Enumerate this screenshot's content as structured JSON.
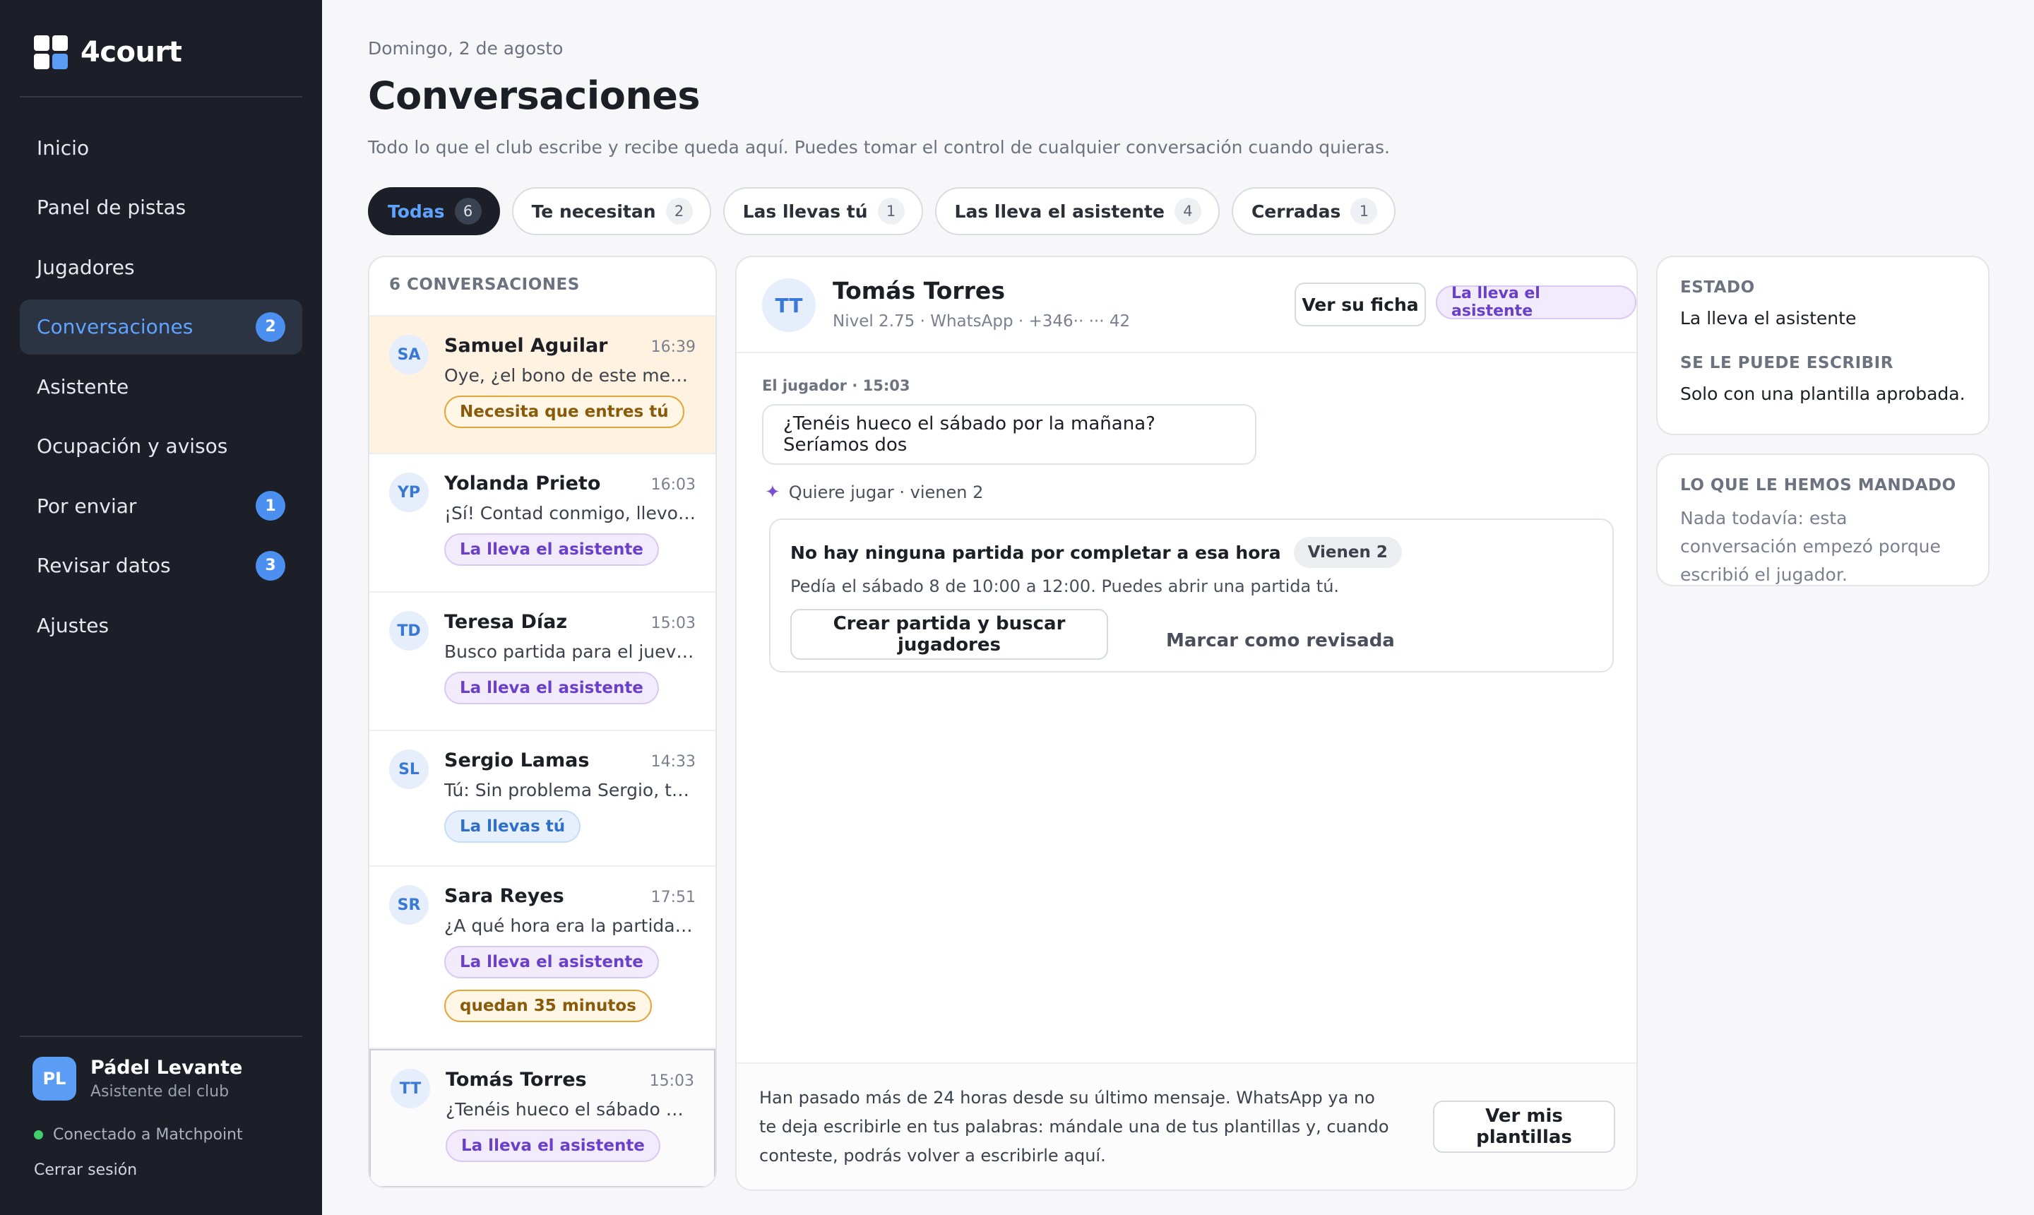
{
  "brand": {
    "name": "4court"
  },
  "sidebar": {
    "items": [
      {
        "label": "Inicio",
        "badge": ""
      },
      {
        "label": "Panel de pistas",
        "badge": ""
      },
      {
        "label": "Jugadores",
        "badge": ""
      },
      {
        "label": "Conversaciones",
        "badge": "2"
      },
      {
        "label": "Asistente",
        "badge": ""
      },
      {
        "label": "Ocupación y avisos",
        "badge": ""
      },
      {
        "label": "Por enviar",
        "badge": "1"
      },
      {
        "label": "Revisar datos",
        "badge": "3"
      },
      {
        "label": "Ajustes",
        "badge": ""
      }
    ],
    "club": {
      "initials": "PL",
      "name": "Pádel Levante",
      "role": "Asistente del club"
    },
    "connection": "Conectado a Matchpoint",
    "logout": "Cerrar sesión"
  },
  "header": {
    "date": "Domingo, 2 de agosto",
    "title": "Conversaciones",
    "subtitle": "Todo lo que el club escribe y recibe queda aquí. Puedes tomar el control de cualquier conversación cuando quieras."
  },
  "tabs": [
    {
      "label": "Todas",
      "count": "6"
    },
    {
      "label": "Te necesitan",
      "count": "2"
    },
    {
      "label": "Las llevas tú",
      "count": "1"
    },
    {
      "label": "Las lleva el asistente",
      "count": "4"
    },
    {
      "label": "Cerradas",
      "count": "1"
    }
  ],
  "list": {
    "header": "6 CONVERSACIONES",
    "conversations": [
      {
        "initials": "SA",
        "name": "Samuel Aguilar",
        "time": "16:39",
        "snippet": "Oye, ¿el bono de este mes lo p...",
        "tags": [
          "Necesita que entres tú"
        ]
      },
      {
        "initials": "YP",
        "name": "Yolanda Prieto",
        "time": "16:03",
        "snippet": "¡Sí! Contad conmigo, llevo yo la...",
        "tags": [
          "La lleva el asistente"
        ]
      },
      {
        "initials": "TD",
        "name": "Teresa Díaz",
        "time": "15:03",
        "snippet": "Busco partida para el jueves po...",
        "tags": [
          "La lleva el asistente"
        ]
      },
      {
        "initials": "SL",
        "name": "Sergio Lamas",
        "time": "14:33",
        "snippet": "Tú: Sin problema Sergio, te quit...",
        "tags": [
          "La llevas tú"
        ]
      },
      {
        "initials": "SR",
        "name": "Sara Reyes",
        "time": "17:51",
        "snippet": "¿A qué hora era la partida del v...",
        "tags": [
          "La lleva el asistente",
          "quedan 35 minutos"
        ]
      },
      {
        "initials": "TT",
        "name": "Tomás Torres",
        "time": "15:03",
        "snippet": "¿Tenéis hueco el sábado por la ...",
        "tags": [
          "La lleva el asistente"
        ]
      }
    ]
  },
  "chat": {
    "initials": "TT",
    "name": "Tomás Torres",
    "meta": "Nivel 2.75 · WhatsApp · +346·· ··· 42",
    "profile_button": "Ver su ficha",
    "status": "La lleva el asistente",
    "message_meta": "El jugador · 15:03",
    "message": "¿Tenéis hueco el sábado por la mañana? Seríamos dos",
    "intent": "Quiere jugar · vienen 2",
    "card": {
      "title": "No hay ninguna partida por completar a esa hora",
      "chip": "Vienen 2",
      "description": "Pedía el sábado 8 de 10:00 a 12:00. Puedes abrir una partida tú.",
      "primary": "Crear partida y buscar jugadores",
      "secondary": "Marcar como revisada"
    },
    "footer_text": "Han pasado más de 24 horas desde su último mensaje. WhatsApp ya no te deja escribirle en tus palabras: mándale una de tus plantillas y, cuando conteste, podrás volver a escribirle aquí.",
    "footer_button": "Ver mis plantillas"
  },
  "details": {
    "state_label": "ESTADO",
    "state_value": "La lleva el asistente",
    "write_label": "SE LE PUEDE ESCRIBIR",
    "write_value": "Solo con una plantilla aprobada.",
    "sent_label": "LO QUE LE HEMOS MANDADO",
    "sent_value": "Nada todavía: esta conversación empezó porque escribió el jugador."
  },
  "colors": {
    "sidebar_bg": "#1c1f28",
    "accent": "#5ea4ff",
    "badge": "#4b8ff0",
    "urgent_bg": "#fff2e0",
    "assistant_purple": "#6a3fc9"
  }
}
